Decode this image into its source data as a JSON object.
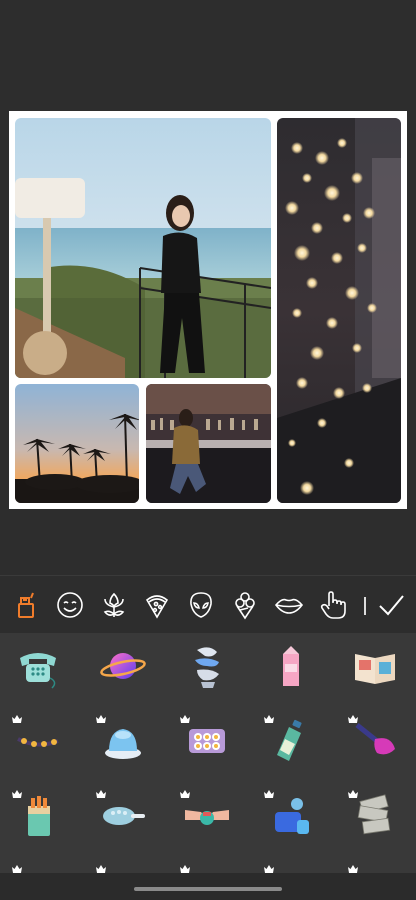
{
  "collage": {
    "layout": "grid-4",
    "photos": [
      {
        "name": "photo-woman-balcony-beach"
      },
      {
        "name": "photo-bokeh-lights-street"
      },
      {
        "name": "photo-palm-trees-sunset"
      },
      {
        "name": "photo-woman-bar-counter"
      }
    ]
  },
  "categories": [
    {
      "icon": "lighter-icon",
      "active": true
    },
    {
      "icon": "smiley-icon",
      "active": false
    },
    {
      "icon": "flower-icon",
      "active": false
    },
    {
      "icon": "pizza-icon",
      "active": false
    },
    {
      "icon": "alien-icon",
      "active": false
    },
    {
      "icon": "ice-cream-icon",
      "active": false
    },
    {
      "icon": "lips-icon",
      "active": false
    },
    {
      "icon": "hand-pointer-icon",
      "active": false
    }
  ],
  "confirm": {
    "icon": "checkmark-icon"
  },
  "stickers": [
    {
      "icon": "telephone-sticker-icon",
      "premium": false
    },
    {
      "icon": "planet-sticker-icon",
      "premium": false
    },
    {
      "icon": "statue-sticker-icon",
      "premium": false
    },
    {
      "icon": "milk-carton-sticker-icon",
      "premium": false
    },
    {
      "icon": "magazine-sticker-icon",
      "premium": false
    },
    {
      "icon": "bracelet-sticker-icon",
      "premium": true
    },
    {
      "icon": "cake-sticker-icon",
      "premium": true
    },
    {
      "icon": "egg-tray-sticker-icon",
      "premium": true
    },
    {
      "icon": "bottle-sticker-icon",
      "premium": true
    },
    {
      "icon": "nail-polish-sticker-icon",
      "premium": true
    },
    {
      "icon": "cigarette-pack-sticker-icon",
      "premium": true
    },
    {
      "icon": "brush-sticker-icon",
      "premium": true
    },
    {
      "icon": "hands-sticker-icon",
      "premium": true
    },
    {
      "icon": "perfume-sticker-icon",
      "premium": true
    },
    {
      "icon": "money-sticker-icon",
      "premium": true
    }
  ],
  "colors": {
    "accent": "#f07c2b",
    "background": "#2b2b2b",
    "sticker_panel": "#393939"
  }
}
